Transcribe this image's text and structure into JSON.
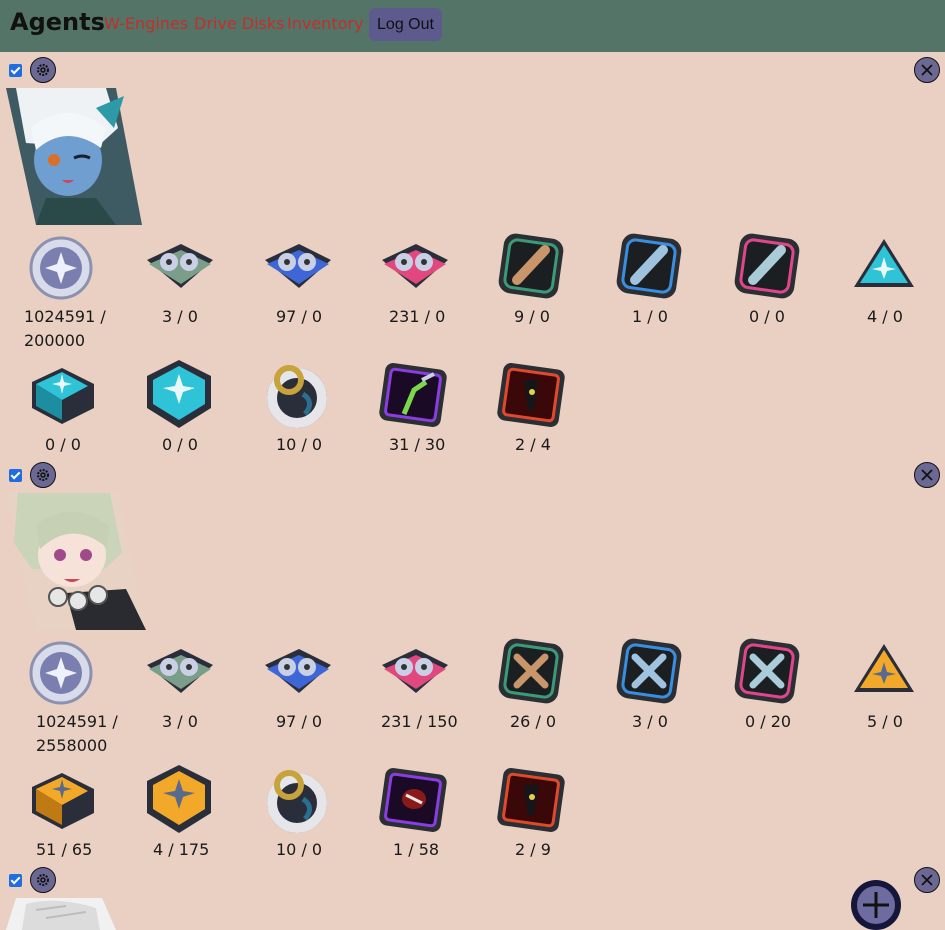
{
  "header": {
    "title": "Agents",
    "nav": [
      "W-Engines",
      "Drive Disks",
      "Inventory"
    ],
    "logout_label": "Log Out"
  },
  "colors": {
    "background": "#e9d0c2",
    "header_bg": "#557468",
    "nav_link": "#c22f2a",
    "button": "#6b6894"
  },
  "agents": [
    {
      "portrait": "agent-portrait-blue-skin-white-hair",
      "counts": [
        "1024591 /",
        "3 / 0",
        "97 / 0",
        "231 / 0",
        "9 / 0",
        "1 / 0",
        "0 / 0",
        "4 / 0",
        "0 / 0",
        "0 / 0",
        "10 / 0",
        "31 / 30",
        "2 / 4"
      ],
      "first_count_line2": "200000"
    },
    {
      "portrait": "agent-portrait-green-hair",
      "counts": [
        "1024591 /",
        "3 / 0",
        "97 / 0",
        "231 / 150",
        "26 / 0",
        "3 / 0",
        "0 / 20",
        "5 / 0",
        "51 / 65",
        "4 / 175",
        "10 / 0",
        "1 / 58",
        "2 / 9"
      ],
      "first_count_line2": "2558000"
    },
    {
      "portrait": "agent-portrait-white-hair"
    }
  ],
  "materials": [
    "dennies-coin-icon",
    "tape-green-icon",
    "tape-blue-icon",
    "tape-pink-icon",
    "chip-green-icon",
    "chip-blue-icon",
    "chip-pink-icon",
    "triangle-material-icon",
    "box-material-icon",
    "hex-material-icon",
    "ring-material-icon",
    "boss-material-a-icon",
    "boss-material-b-icon"
  ]
}
